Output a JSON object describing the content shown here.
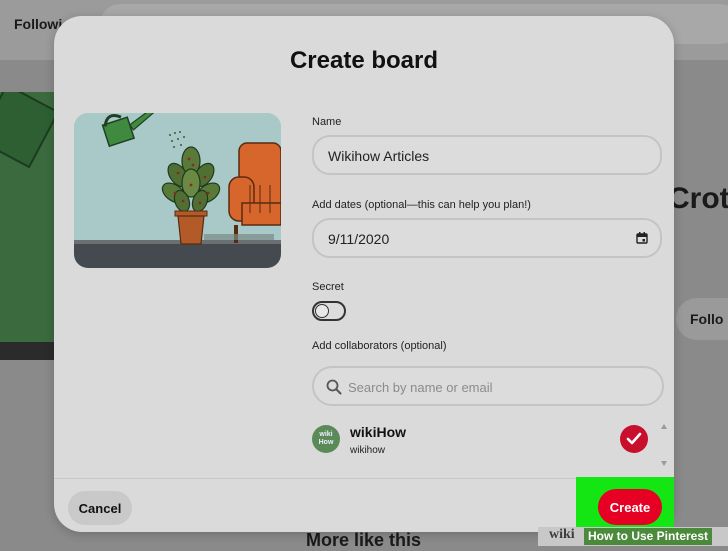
{
  "background": {
    "following_label": "Followi",
    "title_fragment": "Crot",
    "follow_button": "Follo",
    "more_like_this": "More like this"
  },
  "modal": {
    "title": "Create board",
    "name": {
      "label": "Name",
      "value": "Wikihow Articles"
    },
    "dates": {
      "label": "Add dates (optional—this can help you plan!)",
      "value": "9/11/2020"
    },
    "secret": {
      "label": "Secret",
      "enabled": false
    },
    "collaborators": {
      "label": "Add collaborators (optional)",
      "search_placeholder": "Search by name or email",
      "items": [
        {
          "avatar_text": "wiki How",
          "name": "wikiHow",
          "handle": "wikihow",
          "selected": true
        }
      ]
    },
    "cancel_label": "Cancel",
    "create_label": "Create"
  },
  "colors": {
    "create_button": "#e60023",
    "highlight": "#13e613",
    "check_button": "#c8102e"
  },
  "watermark": {
    "wiki": "wiki",
    "text": "How to Use Pinterest"
  }
}
